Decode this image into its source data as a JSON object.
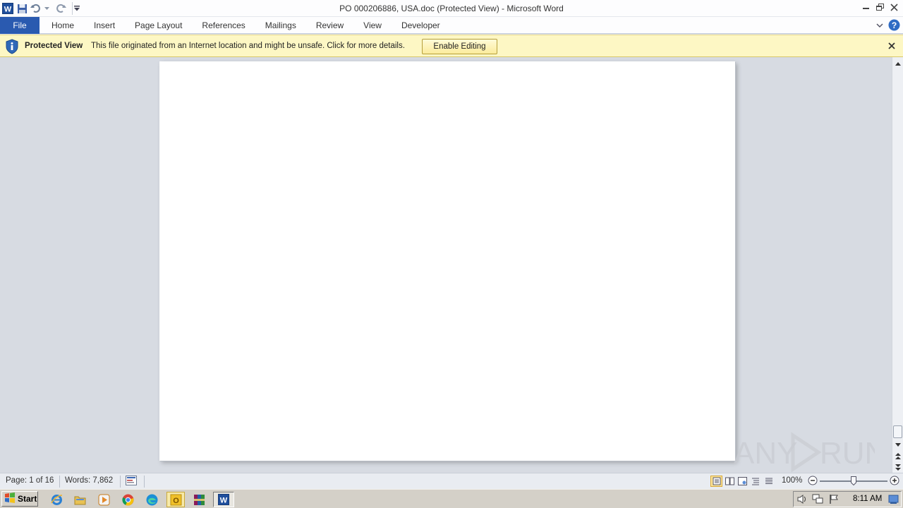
{
  "window": {
    "title": "PO 000206886, USA.doc (Protected View)  -  Microsoft Word"
  },
  "quick_access": {
    "icons": [
      "word-icon",
      "save-icon",
      "undo-icon",
      "redo-icon",
      "customize-icon"
    ]
  },
  "ribbon": {
    "tabs": [
      {
        "label": "File"
      },
      {
        "label": "Home"
      },
      {
        "label": "Insert"
      },
      {
        "label": "Page Layout"
      },
      {
        "label": "References"
      },
      {
        "label": "Mailings"
      },
      {
        "label": "Review"
      },
      {
        "label": "View"
      },
      {
        "label": "Developer"
      }
    ]
  },
  "protected_view": {
    "title": "Protected View",
    "message": "This file originated from an Internet location and might be unsafe. Click for more details.",
    "button_label": "Enable Editing"
  },
  "watermark": {
    "text": "ANY RUN"
  },
  "status": {
    "page": "Page: 1 of 16",
    "words": "Words: 7,862",
    "zoom": "100%",
    "zoom_level": 1.0
  },
  "taskbar": {
    "start_label": "Start",
    "clock": "8:11 AM",
    "apps": [
      "internet-explorer-icon",
      "file-explorer-icon",
      "media-player-icon",
      "chrome-icon",
      "edge-icon",
      "outlook-icon",
      "winrar-icon",
      "word-taskbar-icon"
    ]
  },
  "colors": {
    "file_tab": "#2a5ab0",
    "protected_bar": "#fdf7c4",
    "doc_background": "#d7dbe2"
  }
}
